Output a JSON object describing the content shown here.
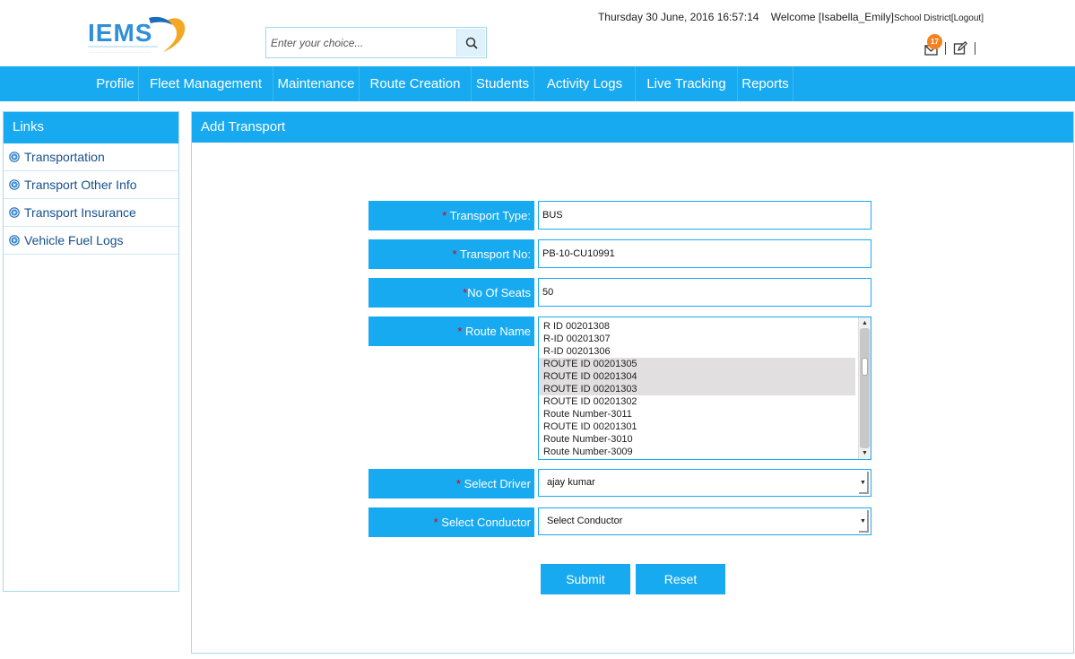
{
  "header": {
    "logo_text": "IEMS",
    "search_placeholder": "Enter your choice...",
    "datetime": "Thursday 30 June, 2016 16:57:14",
    "welcome": "Welcome [Isabella_Emily]",
    "district": "School District",
    "logout": "[Logout]",
    "notification_count": "17"
  },
  "nav": {
    "items": [
      "Profile",
      "Fleet Management",
      "Maintenance",
      "Route Creation",
      "Students",
      "Activity Logs",
      "Live Tracking",
      "Reports"
    ]
  },
  "sidebar": {
    "title": "Links",
    "items": [
      "Transportation",
      "Transport Other Info",
      "Transport Insurance",
      "Vehicle Fuel Logs"
    ]
  },
  "form": {
    "title": "Add Transport",
    "required_mark": "*",
    "transport_type_label": " Transport Type:",
    "transport_type_value": "BUS",
    "transport_no_label": " Transport No:",
    "transport_no_value": "PB-10-CU10991",
    "seats_label": "No Of Seats",
    "seats_value": "50",
    "route_label": " Route Name",
    "routes": [
      {
        "label": "R ID 00201308",
        "selected": false
      },
      {
        "label": "R-ID 00201307",
        "selected": false
      },
      {
        "label": "R-ID 00201306",
        "selected": false
      },
      {
        "label": "ROUTE ID 00201305",
        "selected": true
      },
      {
        "label": "ROUTE ID 00201304",
        "selected": true
      },
      {
        "label": "ROUTE ID 00201303",
        "selected": true
      },
      {
        "label": "ROUTE ID 00201302",
        "selected": false
      },
      {
        "label": "Route Number-3011",
        "selected": false
      },
      {
        "label": "ROUTE ID 00201301",
        "selected": false
      },
      {
        "label": "Route Number-3010",
        "selected": false
      },
      {
        "label": "Route Number-3009",
        "selected": false
      }
    ],
    "driver_label": " Select Driver",
    "driver_value": "ajay kumar",
    "conductor_label": " Select Conductor",
    "conductor_value": "Select Conductor",
    "submit_label": "Submit",
    "reset_label": "Reset"
  },
  "colors": {
    "primary": "#18aaf0",
    "required": "#d0021b",
    "badge": "#f6821f",
    "link": "#16508d"
  }
}
